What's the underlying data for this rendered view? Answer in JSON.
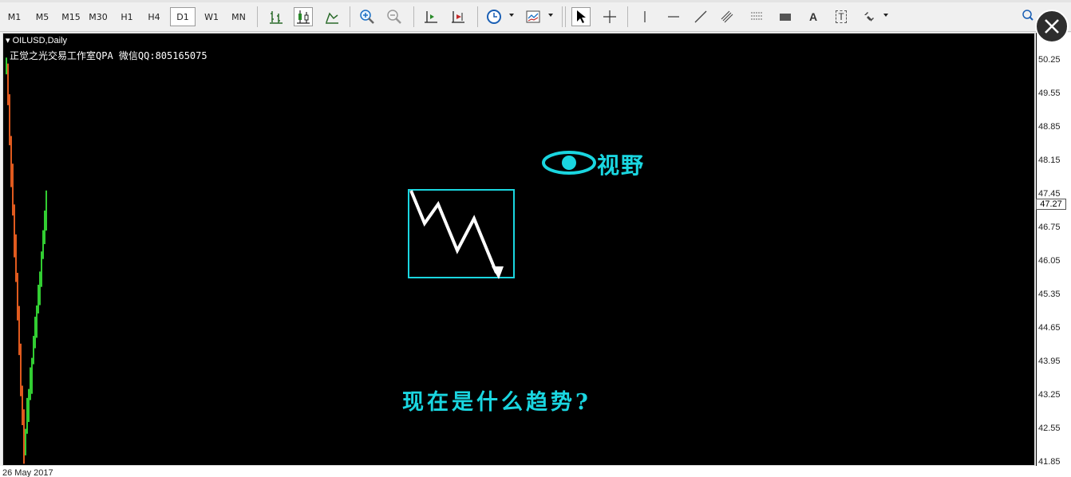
{
  "toolbar": {
    "timeframes": [
      "M1",
      "M5",
      "M15",
      "M30",
      "H1",
      "H4",
      "D1",
      "W1",
      "MN"
    ],
    "active_timeframe": "D1",
    "text_tool_label": "A",
    "label_tool_label": "T"
  },
  "chart": {
    "symbol_label": "OILUSD,Daily",
    "comment": "正觉之光交易工作室QPA 微信QQ:805165075",
    "vision_text": "视野",
    "question_text": "现在是什么趋势?",
    "current_price": "47.27",
    "price_labels": [
      "50.25",
      "49.55",
      "48.85",
      "48.15",
      "47.45",
      "46.75",
      "46.05",
      "45.35",
      "44.65",
      "43.95",
      "43.25",
      "42.55",
      "41.85"
    ],
    "date_label": "26 May 2017"
  },
  "colors": {
    "annotation": "#1ad6e0",
    "bull_candle": "#32cd32",
    "bear_candle": "#e05a1e",
    "chart_background": "#000000"
  }
}
